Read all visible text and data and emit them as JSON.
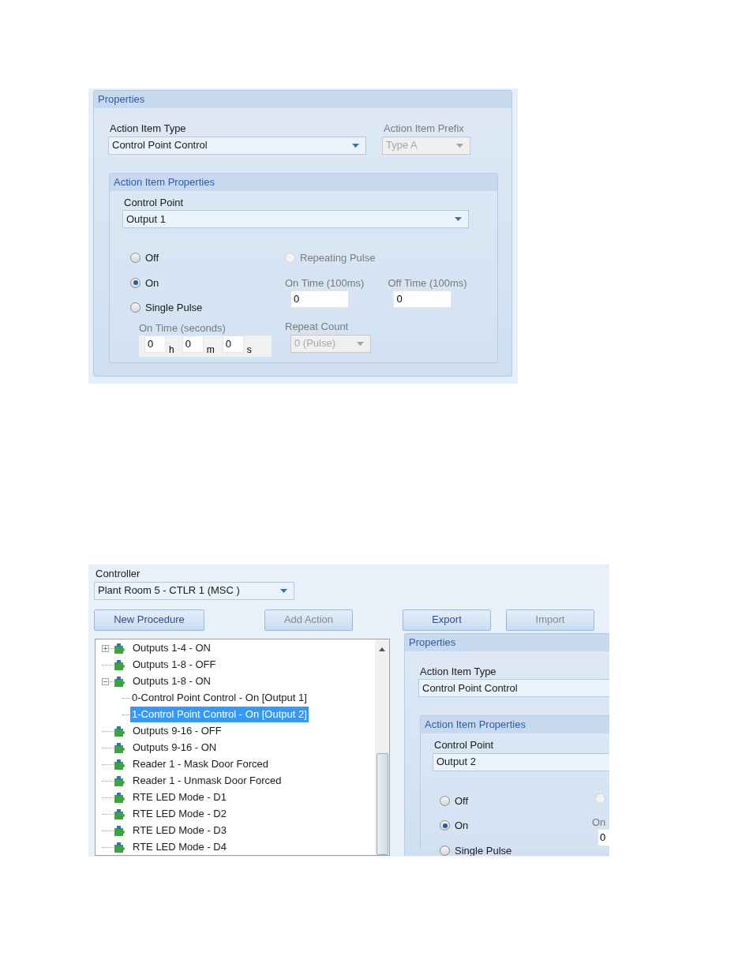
{
  "screen_1": {
    "panel_title": "Properties",
    "action_item_type": {
      "label": "Action Item Type",
      "value": "Control Point Control",
      "disabled": false
    },
    "action_item_prefix": {
      "label": "Action Item Prefix",
      "value": "Type A",
      "disabled": true
    },
    "action_item_properties": {
      "title": "Action Item Properties",
      "control_point": {
        "label": "Control Point",
        "value": "Output 1",
        "disabled": false
      },
      "modes": [
        {
          "label": "Off",
          "selected": false,
          "disabled": false
        },
        {
          "label": "On",
          "selected": true,
          "disabled": false
        },
        {
          "label": "Single Pulse",
          "selected": false,
          "disabled": false
        }
      ],
      "repeating_pulse": {
        "label": "Repeating Pulse",
        "selected": false,
        "disabled": true
      },
      "on_time_100ms": {
        "label": "On Time (100ms)",
        "value": "0"
      },
      "off_time_100ms": {
        "label": "Off Time (100ms)",
        "value": "0"
      },
      "on_time_seconds": {
        "label": "On Time (seconds)",
        "fields": [
          {
            "value": "0",
            "unit": "h"
          },
          {
            "value": "0",
            "unit": "m"
          },
          {
            "value": "0",
            "unit": "s"
          }
        ]
      },
      "repeat_count": {
        "label": "Repeat Count",
        "value": "0 (Pulse)",
        "disabled": true
      }
    }
  },
  "screen_2": {
    "controller": {
      "label": "Controller",
      "value": "Plant Room 5 - CTLR 1 (MSC )",
      "disabled": false
    },
    "buttons": [
      {
        "label": "New Procedure",
        "disabled": false
      },
      {
        "label": "Add Action",
        "disabled": true
      },
      {
        "label": "Export",
        "disabled": false
      },
      {
        "label": "Import",
        "disabled": true
      }
    ],
    "tree": [
      {
        "label": "Outputs 1-4 - ON",
        "kind": "collapsed",
        "selected": false
      },
      {
        "label": "Outputs 1-8 - OFF",
        "kind": "leaf",
        "selected": false
      },
      {
        "label": "Outputs 1-8 - ON",
        "kind": "expanded",
        "selected": false,
        "children": [
          {
            "label": "0-Control Point Control - On [Output 1]",
            "selected": false
          },
          {
            "label": "1-Control Point Control - On [Output 2]",
            "selected": true
          }
        ]
      },
      {
        "label": "Outputs 9-16 - OFF",
        "kind": "leaf",
        "selected": false
      },
      {
        "label": "Outputs 9-16 - ON",
        "kind": "leaf",
        "selected": false
      },
      {
        "label": "Reader 1 - Mask Door Forced",
        "kind": "leaf",
        "selected": false
      },
      {
        "label": "Reader 1 - Unmask Door Forced",
        "kind": "leaf",
        "selected": false
      },
      {
        "label": "RTE LED Mode - D1",
        "kind": "leaf",
        "selected": false
      },
      {
        "label": "RTE LED Mode - D2",
        "kind": "leaf",
        "selected": false
      },
      {
        "label": "RTE LED Mode - D3",
        "kind": "leaf",
        "selected": false
      },
      {
        "label": "RTE LED Mode - D4",
        "kind": "leaf",
        "selected": false
      }
    ],
    "properties": {
      "panel_title": "Properties",
      "action_item_type": {
        "label": "Action Item Type",
        "value": "Control Point Control",
        "disabled": false
      },
      "action_item_properties": {
        "title": "Action Item Properties",
        "control_point": {
          "label": "Control Point",
          "value": "Output 2",
          "disabled": false
        },
        "modes": [
          {
            "label": "Off",
            "selected": false,
            "disabled": false
          },
          {
            "label": "On",
            "selected": true,
            "disabled": false
          },
          {
            "label": "Single Pulse",
            "selected": false,
            "disabled": false
          }
        ],
        "repeating_pulse": {
          "selected": false,
          "disabled": true
        },
        "on_time_label": "On",
        "on_time_value": "0"
      }
    }
  }
}
